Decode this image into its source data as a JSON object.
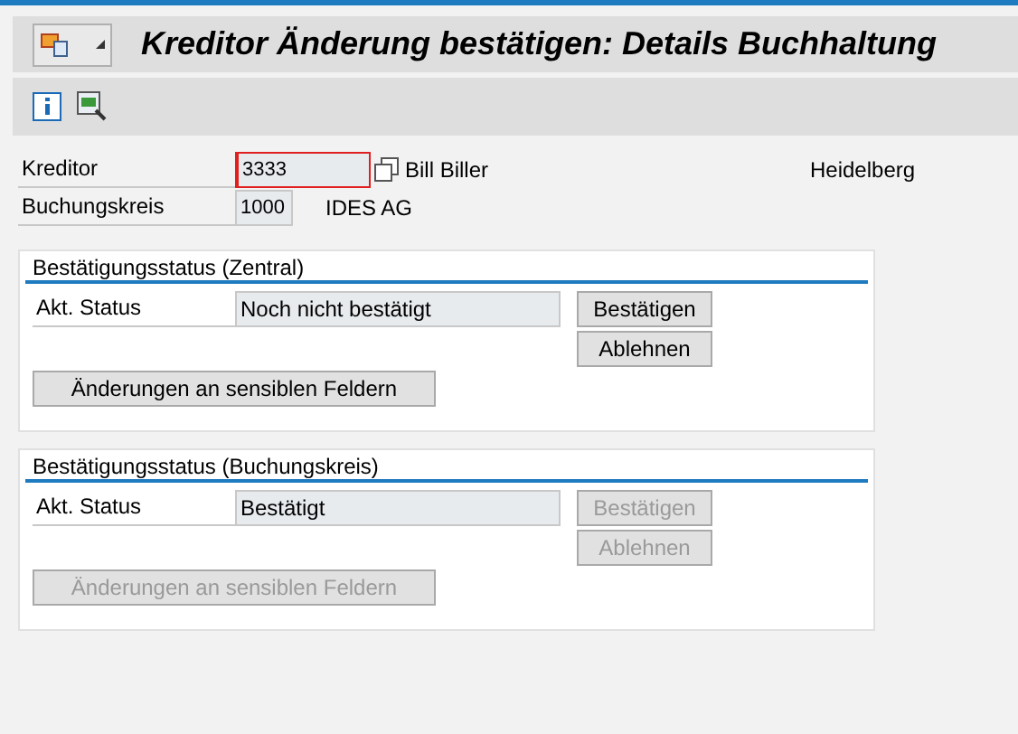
{
  "title": "Kreditor Änderung bestätigen: Details Buchhaltung",
  "fields": [
    {
      "label": "Kreditor",
      "value": "3333",
      "focused": true,
      "name": "Bill Biller",
      "city": "Heidelberg"
    },
    {
      "label": "Buchungskreis",
      "value": "1000",
      "focused": false,
      "name": "IDES AG"
    }
  ],
  "groups": [
    {
      "title": "Bestätigungsstatus (Zentral)",
      "status_label": "Akt. Status",
      "status": "Noch nicht bestätigt",
      "buttons": [
        {
          "label": "Bestätigen",
          "disabled": false
        },
        {
          "label": "Ablehnen",
          "disabled": false
        }
      ],
      "wide_button": {
        "label": "Änderungen an sensiblen Feldern",
        "disabled": false
      }
    },
    {
      "title": "Bestätigungsstatus (Buchungskreis)",
      "status_label": "Akt. Status",
      "status": "Bestätigt",
      "buttons": [
        {
          "label": "Bestätigen",
          "disabled": true
        },
        {
          "label": "Ablehnen",
          "disabled": true
        }
      ],
      "wide_button": {
        "label": "Änderungen an sensiblen Feldern",
        "disabled": true
      }
    }
  ]
}
